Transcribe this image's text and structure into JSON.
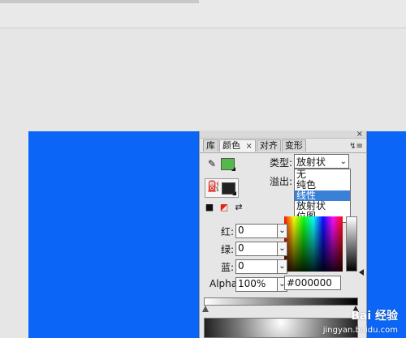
{
  "colors": {
    "stage_blue": "#0b66f7",
    "stroke_swatch": "#55b84a",
    "fill_swatch": "#222222",
    "selection_highlight": "#3a80d6"
  },
  "tabs": [
    {
      "label": "库"
    },
    {
      "label": "颜色",
      "close": "×"
    },
    {
      "label": "对齐"
    },
    {
      "label": "变形"
    }
  ],
  "panel": {
    "close": "×",
    "menu": "↯≡"
  },
  "type": {
    "label": "类型:",
    "selected": "放射状",
    "options": [
      "无",
      "纯色",
      "线性",
      "放射状",
      "位图"
    ],
    "highlighted_index": 2
  },
  "overflow": {
    "label": "溢出:"
  },
  "rgb": {
    "red_label": "红:",
    "green_label": "绿:",
    "blue_label": "蓝:",
    "alpha_label": "Alpha:",
    "red_value": "0",
    "green_value": "0",
    "blue_value": "0",
    "alpha_value": "100%"
  },
  "hex": {
    "value": "#000000"
  },
  "watermark": {
    "main": "Bai 经验",
    "sub": "jingyan.baidu.com"
  }
}
